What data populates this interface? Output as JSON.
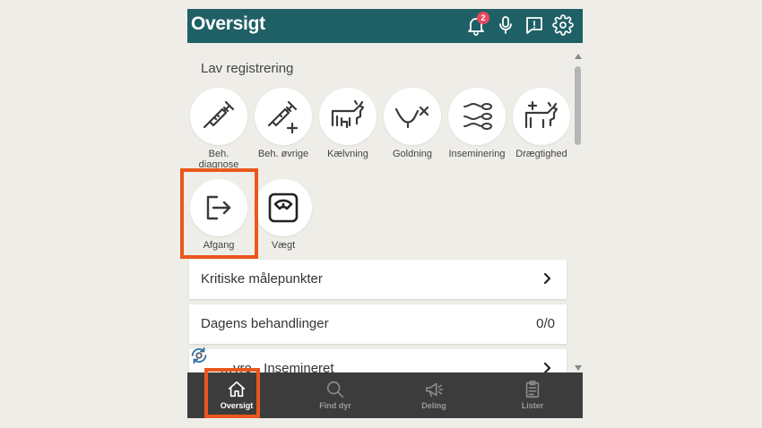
{
  "header": {
    "title": "Oversigt",
    "notification_count": "2",
    "color": "#1f5f66"
  },
  "section": {
    "title": "Lav registrering"
  },
  "tiles": [
    {
      "label": "Beh. diagnose",
      "icon": "syringe-icon"
    },
    {
      "label": "Beh. øvrige",
      "icon": "syringe-plus-icon"
    },
    {
      "label": "Kælvning",
      "icon": "cow-calving-icon"
    },
    {
      "label": "Goldning",
      "icon": "cow-dry-icon"
    },
    {
      "label": "Inseminering",
      "icon": "sperm-icon"
    },
    {
      "label": "Drægtighed",
      "icon": "cow-pregnancy-icon"
    },
    {
      "label": "Afgang",
      "icon": "exit-icon"
    },
    {
      "label": "Vægt",
      "icon": "scale-icon"
    }
  ],
  "list": {
    "critical": "Kritiske målepunkter",
    "treatments": "Dagens behandlinger",
    "treatments_count": "0/0",
    "inseminated": "…yre - Insemineret"
  },
  "nav": {
    "overview": "Oversigt",
    "find": "Find dyr",
    "share": "Deling",
    "lists": "Lister"
  },
  "highlight_color": "#e8581c"
}
